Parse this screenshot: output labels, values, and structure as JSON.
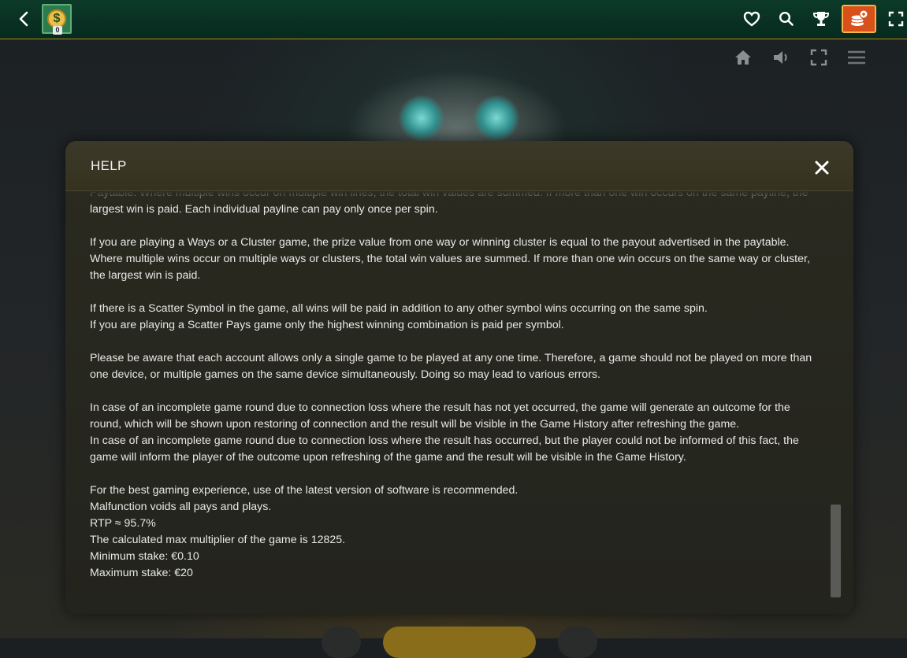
{
  "header": {
    "logo_symbol": "$",
    "logo_badge": "0",
    "icons": [
      "back-icon",
      "heart-icon",
      "search-icon",
      "trophy-icon",
      "cashier-icon",
      "fullscreen-icon"
    ],
    "accent_color": "#b8891c",
    "cashier_color": "#d8501a"
  },
  "game_toolbar": {
    "icons": [
      "home-icon",
      "sound-icon",
      "game-fullscreen-icon",
      "menu-icon"
    ]
  },
  "modal": {
    "title": "HELP",
    "paragraphs": [
      [
        "Paytable. Where multiple wins occur on multiple win lines, the total win values are summed. If more than one win occurs on the same payline, the largest win is paid. Each individual payline can pay only once per spin."
      ],
      [
        "If you are playing a Ways or a Cluster game, the prize value from one way or winning cluster is equal to the payout advertised in the paytable. Where multiple wins occur on multiple ways or clusters, the total win values are summed. If more than one win occurs on the same way or cluster, the largest win is paid."
      ],
      [
        "If there is a Scatter Symbol in the game, all wins will be paid in addition to any other symbol wins occurring on the same spin.",
        "If you are playing a Scatter Pays game only the highest winning combination is paid per symbol."
      ],
      [
        "Please be aware that each account allows only a single game to be played at any one time. Therefore, a game should not be played on more than one device, or multiple games on the same device simultaneously. Doing so may lead to various errors."
      ],
      [
        "In case of an incomplete game round due to connection loss where the result has not yet occurred, the game will generate an outcome for the round, which will be shown upon restoring of connection and the result will be visible in the Game History after refreshing the game.",
        "In case of an incomplete game round due to connection loss where the result has occurred, but the player could not be informed of this fact, the game will inform the player of the outcome upon refreshing of the game and the result will be visible in the Game History."
      ],
      [
        "For the best gaming experience, use of the latest version of software is recommended.",
        "Malfunction voids all pays and plays.",
        "RTP ≈ 95.7%",
        "The calculated max multiplier of the game is 12825.",
        "Minimum stake: €0.10",
        "Maximum stake: €20"
      ]
    ],
    "scroll_position": 0.97
  }
}
